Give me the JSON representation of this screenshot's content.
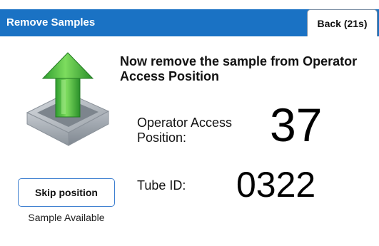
{
  "header": {
    "title": "Remove Samples",
    "back_label": "Back (21s)"
  },
  "instruction": "Now remove the sample from Operator Access Position",
  "position": {
    "label": "Operator Access Position:",
    "value": "37"
  },
  "tube": {
    "label": "Tube ID:",
    "value": "0322"
  },
  "skip": {
    "label": "Skip position",
    "caption": "Sample Available"
  },
  "colors": {
    "header_bar": "#1a72c4",
    "arrow_green": "#3bb33b",
    "tray_gray": "#a9afb6"
  },
  "icons": {
    "illustration": "tray-upload-arrow-icon"
  }
}
